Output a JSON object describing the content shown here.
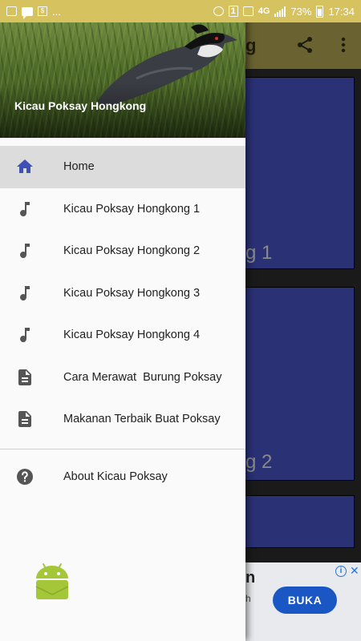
{
  "status_bar": {
    "left_more": "...",
    "sim_badge": "1",
    "network": "4G",
    "battery_percent": "73%",
    "time": "17:34"
  },
  "background_app": {
    "title_fragment": "g",
    "cards": [
      {
        "label_fragment": "g 1"
      },
      {
        "label_fragment": "g 2"
      }
    ],
    "ad": {
      "title_fragment": "n",
      "subtitle_fragment": "h",
      "button_label": "BUKA"
    }
  },
  "drawer": {
    "header_title": "Kicau Poksay Hongkong",
    "items": [
      {
        "label": "Home",
        "icon": "home-icon",
        "selected": true
      },
      {
        "label": "Kicau Poksay Hongkong 1",
        "icon": "music-note-icon"
      },
      {
        "label": "Kicau Poksay Hongkong 2",
        "icon": "music-note-icon"
      },
      {
        "label": "Kicau Poksay Hongkong 3",
        "icon": "music-note-icon"
      },
      {
        "label": "Kicau Poksay Hongkong 4",
        "icon": "music-note-icon"
      },
      {
        "label": "Cara Merawat  Burung Poksay",
        "icon": "document-icon"
      },
      {
        "label": "Makanan Terbaik Buat Poksay",
        "icon": "document-icon"
      }
    ],
    "secondary_items": [
      {
        "label": "About Kicau Poksay",
        "icon": "help-icon"
      }
    ]
  },
  "colors": {
    "status_bar": "#d6c25e",
    "toolbar_dimmed": "#6a6230",
    "home_icon": "#3f51b5",
    "card": "#2a3175",
    "ad_button": "#1a57c5",
    "android_green": "#a4c639"
  }
}
